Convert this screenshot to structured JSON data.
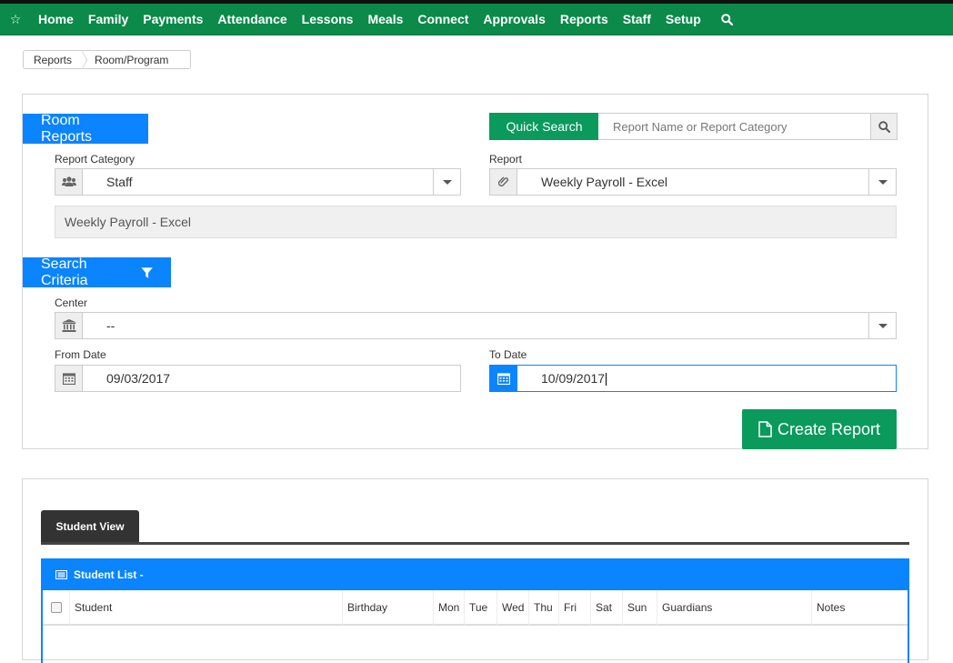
{
  "nav": {
    "items": [
      "Home",
      "Family",
      "Payments",
      "Attendance",
      "Lessons",
      "Meals",
      "Connect",
      "Approvals",
      "Reports",
      "Staff",
      "Setup"
    ]
  },
  "breadcrumb": {
    "items": [
      "Reports",
      "Room/Program"
    ]
  },
  "room_reports": {
    "title": "Room Reports",
    "report_category_label": "Report Category",
    "report_category_value": "Staff",
    "report_label": "Report",
    "report_value": "Weekly Payroll - Excel",
    "description": "Weekly Payroll - Excel"
  },
  "quick_search": {
    "button_label": "Quick Search",
    "placeholder": "Report Name or Report Category"
  },
  "search_criteria": {
    "title": "Search Criteria",
    "center_label": "Center",
    "center_value": "--",
    "from_date_label": "From Date",
    "from_date_value": "09/03/2017",
    "to_date_label": "To Date",
    "to_date_value": "10/09/2017"
  },
  "create_report_label": "Create Report",
  "student_view": {
    "tab_label": "Student View",
    "list_title": "Student List -",
    "columns": [
      "Student",
      "Birthday",
      "Mon",
      "Tue",
      "Wed",
      "Thu",
      "Fri",
      "Sat",
      "Sun",
      "Guardians",
      "Notes"
    ]
  },
  "colors": {
    "nav_green": "#0b8a4a",
    "accent_blue": "#0a84ff",
    "action_green": "#0a9a5c"
  }
}
